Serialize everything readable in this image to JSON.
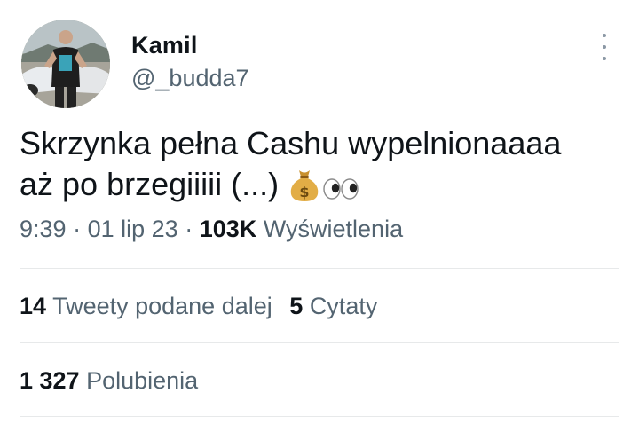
{
  "author": {
    "display_name": "Kamil",
    "handle": "@_budda7",
    "avatar_icon": "user-photo"
  },
  "tweet": {
    "text_line1": "Skrzynka pełna Cashu wypelnionaaaa",
    "text_line2": "aż po brzegiiiii (...)",
    "emojis": [
      "money-bag-icon",
      "eyes-icon"
    ]
  },
  "meta": {
    "time": "9:39",
    "date": "01 lip 23",
    "views_count": "103K",
    "views_label": "Wyświetlenia",
    "separator": "·"
  },
  "stats": {
    "retweets_count": "14",
    "retweets_label": "Tweety podane dalej",
    "quotes_count": "5",
    "quotes_label": "Cytaty",
    "likes_count": "1 327",
    "likes_label": "Polubienia"
  }
}
